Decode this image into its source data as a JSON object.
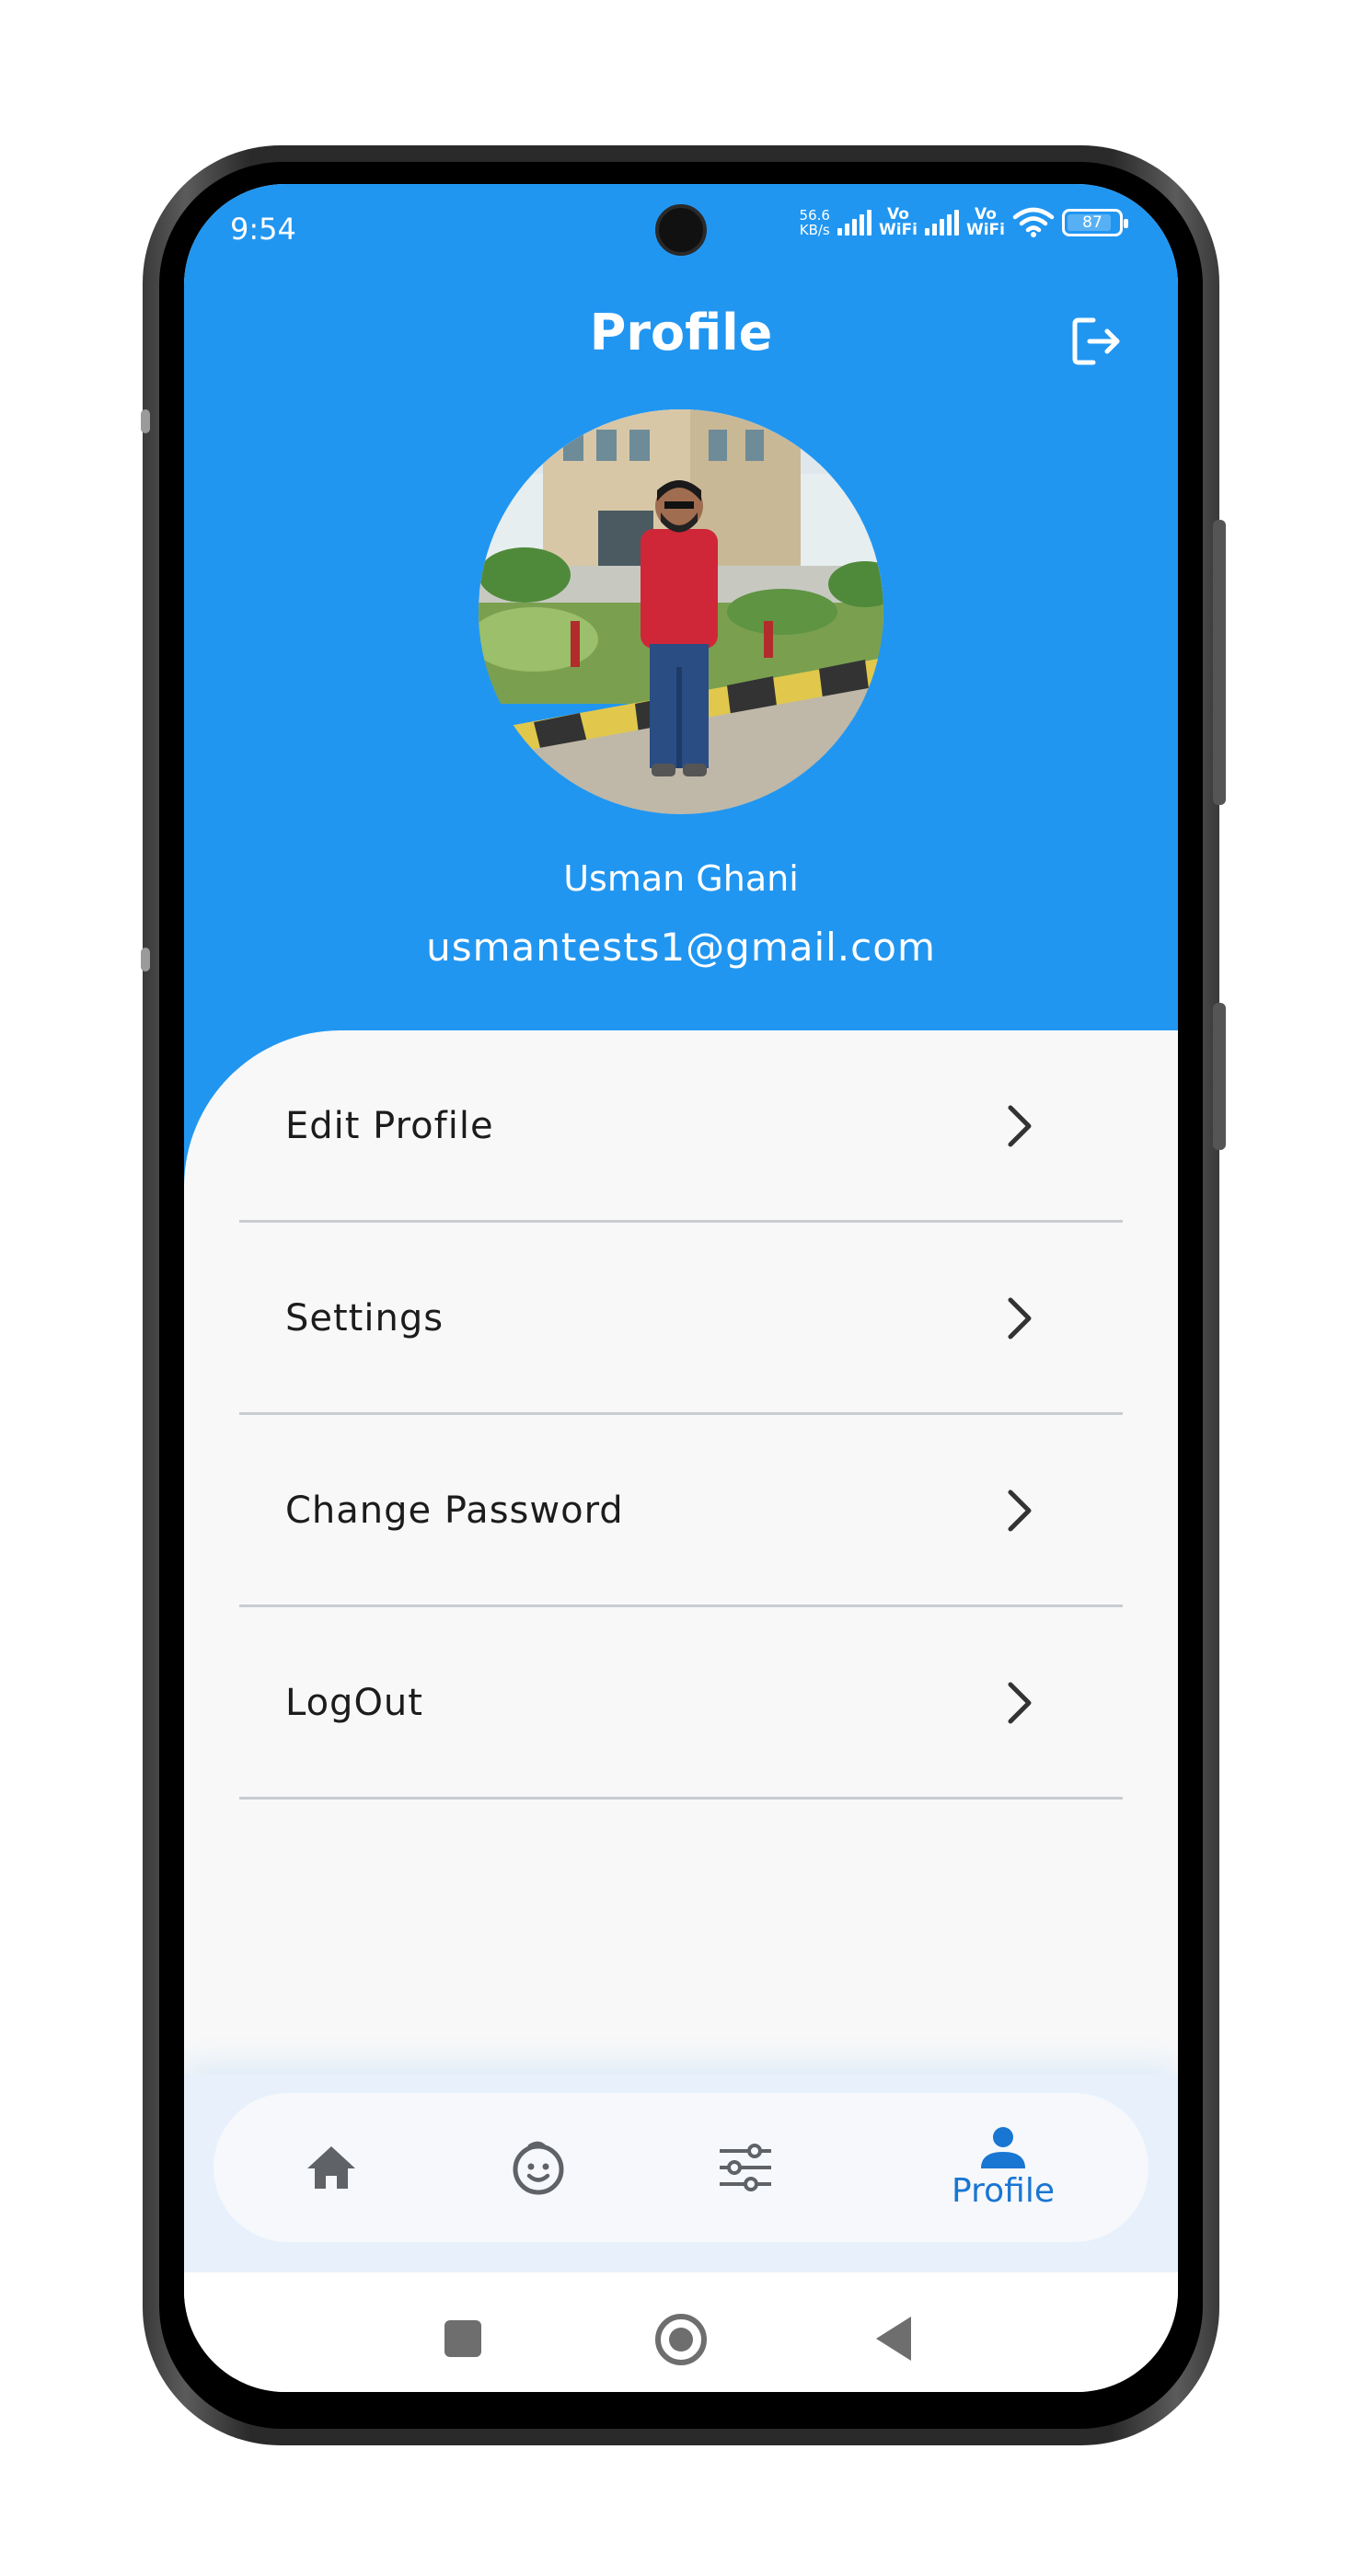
{
  "status_bar": {
    "time": "9:54",
    "net_speed_value": "56.6",
    "net_speed_unit": "KB/s",
    "vowifi_1_top": "Vo",
    "vowifi_1_bottom": "WiFi",
    "vowifi_2_top": "Vo",
    "vowifi_2_bottom": "WiFi",
    "battery": "87"
  },
  "header": {
    "title": "Profile",
    "logout_icon": "logout-icon"
  },
  "profile": {
    "name": "Usman Ghani",
    "email": "usmantests1@gmail.com"
  },
  "menu": {
    "items": [
      {
        "label": "Edit Profile",
        "icon": "chevron-right-icon"
      },
      {
        "label": "Settings",
        "icon": "chevron-right-icon"
      },
      {
        "label": "Change Password",
        "icon": "chevron-right-icon"
      },
      {
        "label": "LogOut",
        "icon": "chevron-right-icon"
      }
    ]
  },
  "bottom_nav": {
    "items": [
      {
        "icon": "home-icon"
      },
      {
        "icon": "child-face-icon"
      },
      {
        "icon": "tune-sliders-icon"
      },
      {
        "icon": "person-icon",
        "label": "Profile",
        "active": true
      }
    ],
    "active_color": "#1976d2"
  },
  "colors": {
    "header_blue": "#2196f1",
    "background": "#f8f8f9",
    "divider": "#c9ccd1"
  }
}
